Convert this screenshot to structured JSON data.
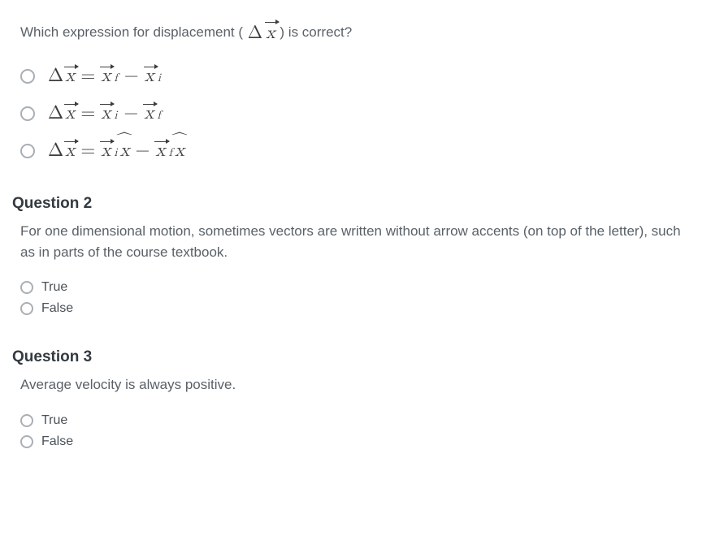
{
  "q1": {
    "stem_prefix": "Which expression for displacement ( ",
    "stem_suffix": " ) is correct?",
    "delta": "Δ",
    "x": "x",
    "xhat": "x",
    "eq": "=",
    "minus": "−",
    "sub_f": "f",
    "sub_i": "i"
  },
  "q2": {
    "heading": "Question 2",
    "stem": "For one dimensional motion, sometimes vectors are written without arrow accents (on top of the letter), such as in parts of the course textbook.",
    "opt_true": "True",
    "opt_false": "False"
  },
  "q3": {
    "heading": "Question 3",
    "stem": "Average velocity is always positive.",
    "opt_true": "True",
    "opt_false": "False"
  }
}
